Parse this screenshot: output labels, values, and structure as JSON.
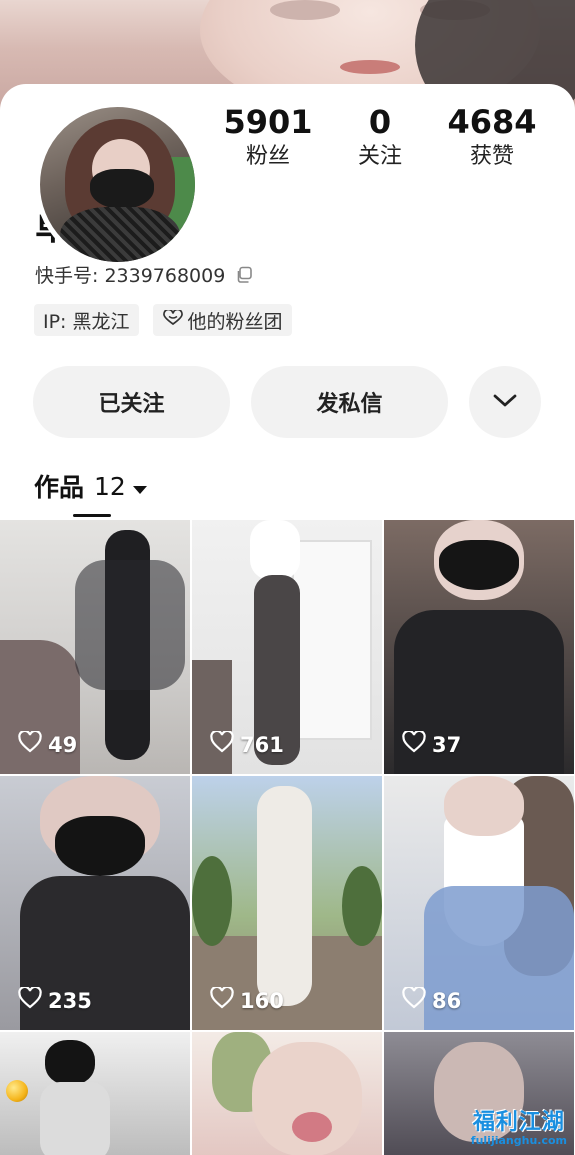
{
  "profile": {
    "nickname": "单身娟娟",
    "kuaishou_id_label": "快手号: 2339768009",
    "tags": [
      {
        "label": "IP: 黑龙江"
      },
      {
        "label": "他的粉丝团",
        "icon": "heart-icon"
      }
    ]
  },
  "stats": [
    {
      "value": "5901",
      "label": "粉丝"
    },
    {
      "value": "0",
      "label": "关注"
    },
    {
      "value": "4684",
      "label": "获赞"
    }
  ],
  "actions": {
    "follow_label": "已关注",
    "message_label": "发私信",
    "more_icon": "chevron-down-icon"
  },
  "works": {
    "tab_label": "作品",
    "count": "12",
    "items": [
      {
        "likes": "49"
      },
      {
        "likes": "761"
      },
      {
        "likes": "37"
      },
      {
        "likes": "235"
      },
      {
        "likes": "160"
      },
      {
        "likes": "86"
      },
      {
        "likes": ""
      },
      {
        "likes": ""
      },
      {
        "likes": ""
      }
    ]
  },
  "watermark": {
    "main": "福利江湖",
    "sub": "fulijianghu.com"
  },
  "colors": {
    "accent": "#1a8fe0",
    "button_bg": "#f2f2f2"
  }
}
